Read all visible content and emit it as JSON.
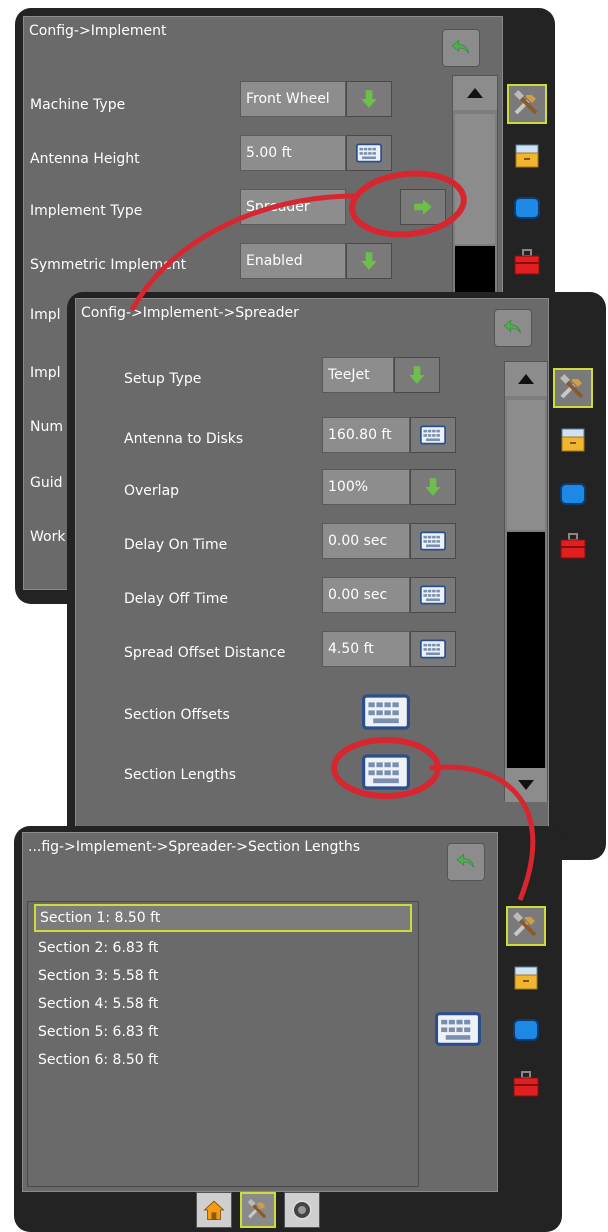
{
  "screen1": {
    "title": "Config->Implement",
    "rows": [
      {
        "label": "Machine Type",
        "value": "Front Wheel"
      },
      {
        "label": "Antenna Height",
        "value": "5.00 ft"
      },
      {
        "label": "Implement Type",
        "value": "Spreader"
      },
      {
        "label": "Symmetric Implement",
        "value": "Enabled"
      },
      {
        "label": "Impl",
        "value": ""
      },
      {
        "label": "Impl",
        "value": ""
      },
      {
        "label": "Num",
        "value": ""
      },
      {
        "label": "Guid",
        "value": ""
      },
      {
        "label": "Work",
        "value": ""
      }
    ]
  },
  "screen2": {
    "title": "Config->Implement->Spreader",
    "rows": [
      {
        "label": "Setup Type",
        "value": "TeeJet"
      },
      {
        "label": "Antenna to Disks",
        "value": "160.80 ft"
      },
      {
        "label": "Overlap",
        "value": "100%"
      },
      {
        "label": "Delay On Time",
        "value": "0.00 sec"
      },
      {
        "label": "Delay Off Time",
        "value": "0.00 sec"
      },
      {
        "label": "Spread Offset Distance",
        "value": "4.50 ft"
      },
      {
        "label": "Section Offsets",
        "value": ""
      },
      {
        "label": "Section Lengths",
        "value": ""
      }
    ]
  },
  "screen3": {
    "title": "...fig->Implement->Spreader->Section Lengths",
    "sections": [
      "Section 1: 8.50 ft",
      "Section 2: 6.83 ft",
      "Section 3: 5.58 ft",
      "Section 4: 5.58 ft",
      "Section 5: 6.83 ft",
      "Section 6: 8.50 ft"
    ]
  },
  "colors": {
    "accent_highlight": "#cddc39",
    "callout_red": "#d7262f",
    "arrow_green": "#6cc04a",
    "panel_bg": "#6a6a6a",
    "frame": "#232323"
  },
  "icons": [
    "back-arrow-icon",
    "down-arrow-icon",
    "right-arrow-icon",
    "keyboard-icon",
    "tools-icon",
    "drawer-icon",
    "screen-icon",
    "toolbox-icon",
    "home-icon",
    "settings-dial-icon",
    "scroll-up-icon",
    "scroll-down-icon"
  ]
}
